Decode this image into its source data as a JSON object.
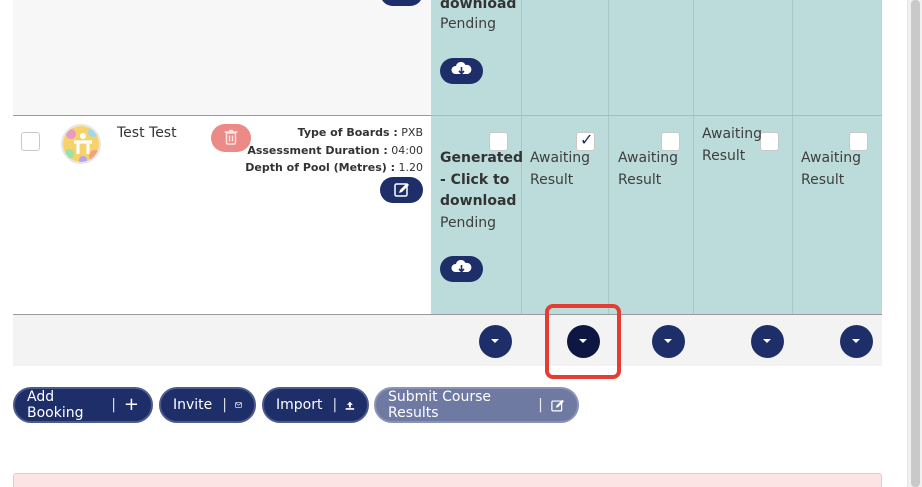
{
  "row_top": {
    "partial_text": "download",
    "status": "Pending"
  },
  "row": {
    "name": "Test Test",
    "details": [
      {
        "label": "Type of Boards :",
        "value": "PXB"
      },
      {
        "label": "Assessment Duration :",
        "value": "04:00"
      },
      {
        "label": "Depth of Pool (Metres) :",
        "value": "1.20"
      }
    ],
    "cert_text_1": "Generated",
    "cert_text_2": "- Click to",
    "cert_text_3": "download",
    "cert_status": "Pending",
    "results": [
      {
        "line1": "Awaiting",
        "line2": "Result",
        "checked": true
      },
      {
        "line1": "Awaiting",
        "line2": "Result",
        "checked": false
      },
      {
        "line1": "Awaiting",
        "line2": "Result",
        "checked": false
      },
      {
        "line1": "Awaiting",
        "line2": "Result",
        "checked": false
      }
    ]
  },
  "actions": {
    "add_booking": "Add Booking",
    "invite": "Invite",
    "import": "Import",
    "submit_results": "Submit Course Results",
    "separator": "|"
  },
  "colors": {
    "navy": "#1d2e68",
    "teal_bg": "#bcdcdb",
    "highlight": "#e53d33",
    "delete": "#eb8a86"
  }
}
